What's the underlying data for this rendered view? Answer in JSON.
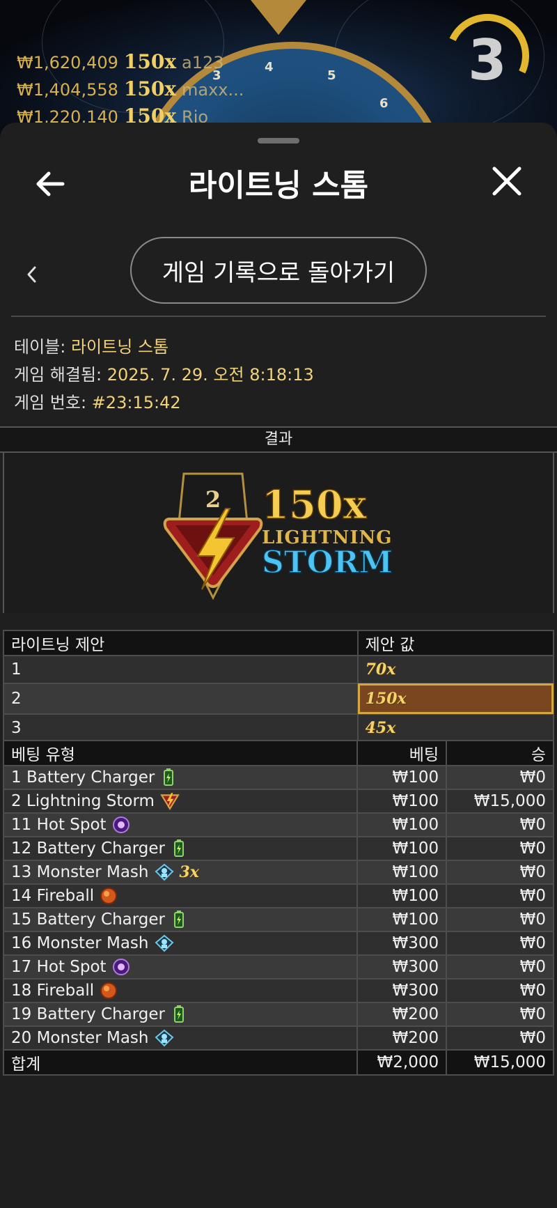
{
  "background": {
    "recent_wins": [
      {
        "amount": "₩1,620,409",
        "mult": "150x",
        "player": "a123"
      },
      {
        "amount": "₩1,404,558",
        "mult": "150x",
        "player": "maxx..."
      },
      {
        "amount": "₩1,220,140",
        "mult": "150x",
        "player": "Rio"
      }
    ],
    "wheel_numbers": [
      "3",
      "4",
      "5",
      "6"
    ],
    "countdown": "3"
  },
  "header": {
    "title": "라이트닝 스톰",
    "back_icon": "arrow-left-icon",
    "close_icon": "close-icon"
  },
  "nav": {
    "back_to_history_label": "게임 기록으로 돌아가기"
  },
  "details": {
    "table_label": "테이블:",
    "table_value": "라이트닝 스톰",
    "resolved_label": "게임 해결됨:",
    "resolved_value": "2025. 7. 29. 오전 8:18:13",
    "game_no_label": "게임 번호:",
    "game_no_value": "#23:15:42"
  },
  "result": {
    "header": "결과",
    "logo": {
      "badge_number": "2",
      "multiplier": "150x",
      "word1": "LIGHTNING",
      "word2": "STORM"
    }
  },
  "offers": {
    "col_offer": "라이트닝 제안",
    "col_value": "제안 값",
    "rows": [
      {
        "n": "1",
        "value": "70x"
      },
      {
        "n": "2",
        "value": "150x"
      },
      {
        "n": "3",
        "value": "45x"
      }
    ],
    "highlighted_row": "2"
  },
  "bets": {
    "col_type": "베팅 유형",
    "col_bet": "베팅",
    "col_win": "승",
    "rows": [
      {
        "type": "1 Battery Charger",
        "icon": "battery-icon",
        "bet": "₩100",
        "win": "₩0"
      },
      {
        "type": "2 Lightning Storm",
        "icon": "lightning-icon",
        "bet": "₩100",
        "win": "₩15,000"
      },
      {
        "type": "11 Hot Spot",
        "icon": "hot-spot-icon",
        "bet": "₩100",
        "win": "₩0"
      },
      {
        "type": "12 Battery Charger",
        "icon": "battery-icon",
        "bet": "₩100",
        "win": "₩0"
      },
      {
        "type": "13 Monster Mash",
        "icon": "monster-icon",
        "extra": "3x",
        "bet": "₩100",
        "win": "₩0"
      },
      {
        "type": "14 Fireball",
        "icon": "fireball-icon",
        "bet": "₩100",
        "win": "₩0"
      },
      {
        "type": "15 Battery Charger",
        "icon": "battery-icon",
        "bet": "₩100",
        "win": "₩0"
      },
      {
        "type": "16 Monster Mash",
        "icon": "monster-icon",
        "bet": "₩300",
        "win": "₩0"
      },
      {
        "type": "17 Hot Spot",
        "icon": "hot-spot-icon",
        "bet": "₩300",
        "win": "₩0"
      },
      {
        "type": "18 Fireball",
        "icon": "fireball-icon",
        "bet": "₩300",
        "win": "₩0"
      },
      {
        "type": "19 Battery Charger",
        "icon": "battery-icon",
        "bet": "₩200",
        "win": "₩0"
      },
      {
        "type": "20 Monster Mash",
        "icon": "monster-icon",
        "bet": "₩200",
        "win": "₩0"
      }
    ],
    "total_label": "합계",
    "total_bet": "₩2,000",
    "total_win": "₩15,000"
  },
  "colors": {
    "gold": "#f4d36a",
    "highlight": "#7a4620",
    "sheet_bg": "#1f1f1f"
  }
}
